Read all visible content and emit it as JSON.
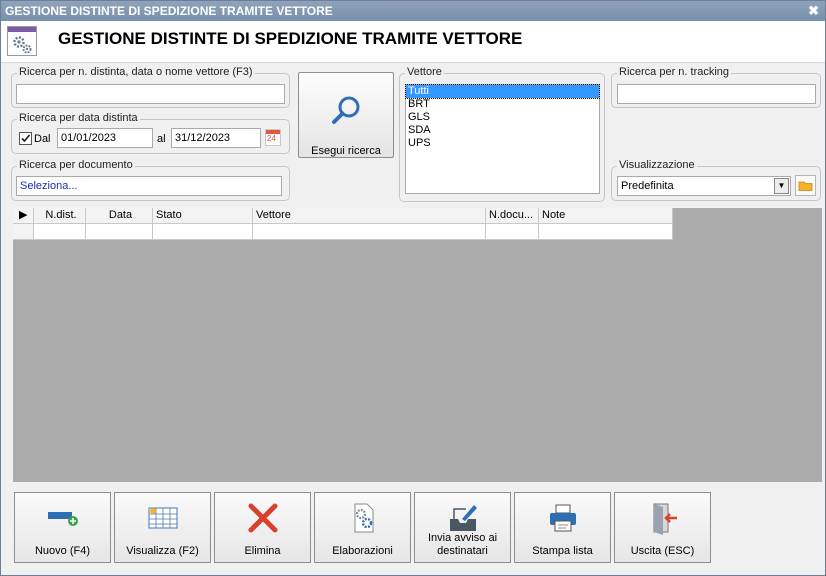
{
  "window": {
    "title": "GESTIONE DISTINTE DI SPEDIZIONE TRAMITE VETTORE",
    "close_glyph": "✖"
  },
  "header": {
    "title": "GESTIONE DISTINTE DI SPEDIZIONE TRAMITE VETTORE",
    "icon": "settings-gear-icon"
  },
  "search_name": {
    "label": "Ricerca per n. distinta, data o nome vettore (F3)",
    "value": ""
  },
  "search_date": {
    "label": "Ricerca per data distinta",
    "checkbox_checked": true,
    "from_label": "Dal",
    "from_value": "01/01/2023",
    "to_label": "al",
    "to_value": "31/12/2023",
    "calendar_day": "24"
  },
  "search_document": {
    "label": "Ricerca per documento",
    "value": "Seleziona..."
  },
  "search_button": {
    "label": "Esegui ricerca",
    "icon": "magnifier-icon"
  },
  "carrier": {
    "label": "Vettore",
    "items": [
      "Tutti",
      "BRT",
      "GLS",
      "SDA",
      "UPS"
    ],
    "selected": "Tutti"
  },
  "tracking": {
    "label": "Ricerca per n. tracking",
    "value": ""
  },
  "view": {
    "label": "Visualizzazione",
    "value": "Predefinita"
  },
  "grid": {
    "columns": [
      "N.dist.",
      "Data",
      "Stato",
      "Vettore",
      "N.docu...",
      "Note"
    ],
    "rows": [
      [
        "",
        "",
        "",
        "",
        "",
        ""
      ]
    ]
  },
  "buttons": {
    "new": "Nuovo (F4)",
    "view": "Visualizza (F2)",
    "delete": "Elimina",
    "processing": "Elaborazioni",
    "notify_line1": "Invia avviso ai",
    "notify_line2": "destinatari",
    "print": "Stampa lista",
    "exit": "Uscita (ESC)"
  },
  "colors": {
    "titlebar": "#7e94ae",
    "selection": "#3399ff",
    "grid_background": "#ababab",
    "accent_blue": "#2d6fb5",
    "delete_red": "#d9412c"
  }
}
